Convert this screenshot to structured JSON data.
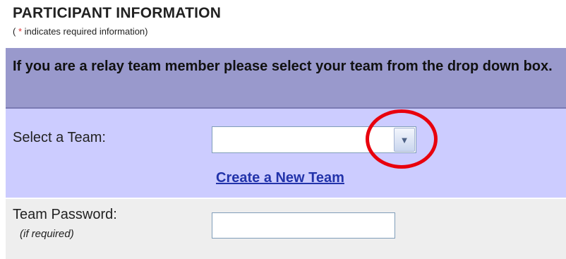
{
  "header": {
    "title": "PARTICIPANT INFORMATION",
    "note_prefix": "( ",
    "note_star": "*",
    "note_suffix": " indicates required information)"
  },
  "team_panel": {
    "instruction": "If you are a relay team member please select your team from the drop down box.",
    "select_label": "Select a Team:",
    "select_value": "",
    "dropdown_icon": "chevron-down-icon",
    "create_link": "Create a New Team"
  },
  "password_row": {
    "label": "Team Password:",
    "sublabel": "(if required)",
    "value": ""
  },
  "annotation": {
    "circle_color": "#e8000d"
  },
  "colors": {
    "panel_header_bg": "#9999cc",
    "panel_bg": "#ccccff",
    "password_row_bg": "#eeeeee",
    "link": "#2233aa"
  }
}
